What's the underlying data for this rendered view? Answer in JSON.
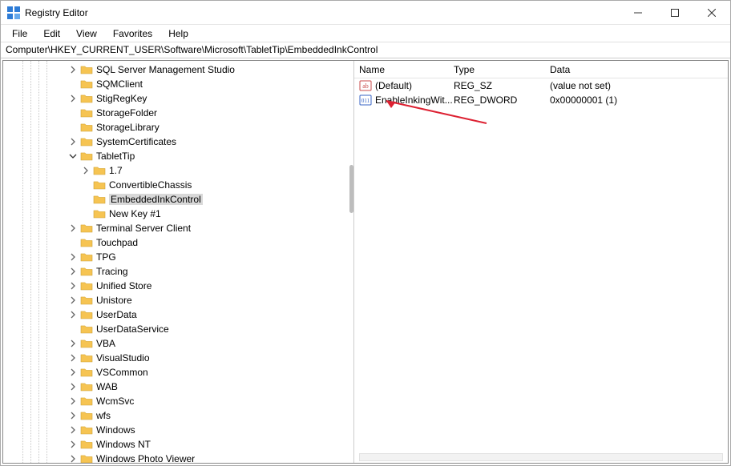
{
  "title": "Registry Editor",
  "menu": {
    "file": "File",
    "edit": "Edit",
    "view": "View",
    "favorites": "Favorites",
    "help": "Help"
  },
  "address": "Computer\\HKEY_CURRENT_USER\\Software\\Microsoft\\TabletTip\\EmbeddedInkControl",
  "tree": [
    {
      "indent": 4,
      "chev": ">",
      "label": "SQL Server Management Studio"
    },
    {
      "indent": 4,
      "chev": "",
      "label": "SQMClient"
    },
    {
      "indent": 4,
      "chev": ">",
      "label": "StigRegKey"
    },
    {
      "indent": 4,
      "chev": "",
      "label": "StorageFolder"
    },
    {
      "indent": 4,
      "chev": "",
      "label": "StorageLibrary"
    },
    {
      "indent": 4,
      "chev": ">",
      "label": "SystemCertificates"
    },
    {
      "indent": 4,
      "chev": "v",
      "label": "TabletTip"
    },
    {
      "indent": 5,
      "chev": ">",
      "label": "1.7"
    },
    {
      "indent": 5,
      "chev": "",
      "label": "ConvertibleChassis"
    },
    {
      "indent": 5,
      "chev": "",
      "label": "EmbeddedInkControl",
      "selected": true
    },
    {
      "indent": 5,
      "chev": "",
      "label": "New Key #1"
    },
    {
      "indent": 4,
      "chev": ">",
      "label": "Terminal Server Client"
    },
    {
      "indent": 4,
      "chev": "",
      "label": "Touchpad"
    },
    {
      "indent": 4,
      "chev": ">",
      "label": "TPG"
    },
    {
      "indent": 4,
      "chev": ">",
      "label": "Tracing"
    },
    {
      "indent": 4,
      "chev": ">",
      "label": "Unified Store"
    },
    {
      "indent": 4,
      "chev": ">",
      "label": "Unistore"
    },
    {
      "indent": 4,
      "chev": ">",
      "label": "UserData"
    },
    {
      "indent": 4,
      "chev": "",
      "label": "UserDataService"
    },
    {
      "indent": 4,
      "chev": ">",
      "label": "VBA"
    },
    {
      "indent": 4,
      "chev": ">",
      "label": "VisualStudio"
    },
    {
      "indent": 4,
      "chev": ">",
      "label": "VSCommon"
    },
    {
      "indent": 4,
      "chev": ">",
      "label": "WAB"
    },
    {
      "indent": 4,
      "chev": ">",
      "label": "WcmSvc"
    },
    {
      "indent": 4,
      "chev": ">",
      "label": "wfs"
    },
    {
      "indent": 4,
      "chev": ">",
      "label": "Windows"
    },
    {
      "indent": 4,
      "chev": ">",
      "label": "Windows NT"
    },
    {
      "indent": 4,
      "chev": ">",
      "label": "Windows Photo Viewer"
    }
  ],
  "list": {
    "headers": {
      "name": "Name",
      "type": "Type",
      "data": "Data"
    },
    "rows": [
      {
        "icon": "string",
        "name": "(Default)",
        "type": "REG_SZ",
        "data": "(value not set)"
      },
      {
        "icon": "binary",
        "name": "EnableInkingWit...",
        "type": "REG_DWORD",
        "data": "0x00000001 (1)"
      }
    ]
  }
}
